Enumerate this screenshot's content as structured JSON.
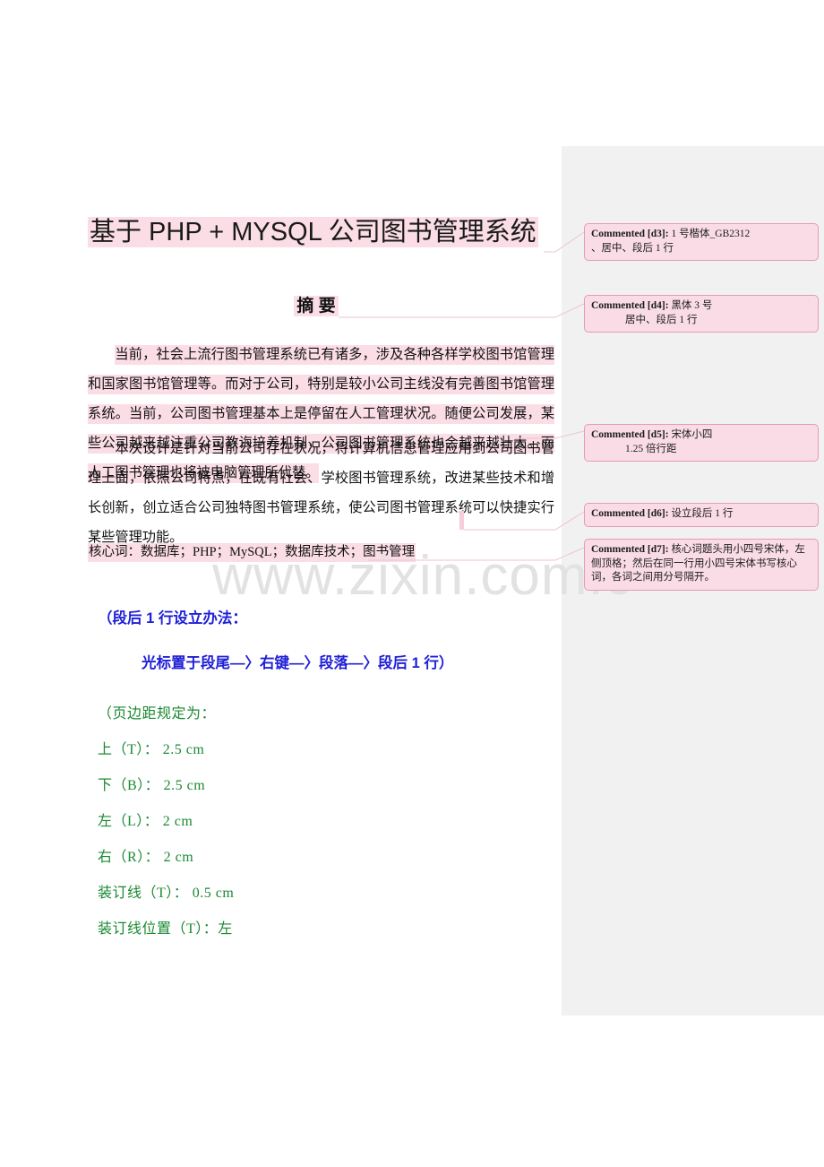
{
  "document": {
    "title": "基于 PHP + MYSQL 公司图书管理系统",
    "abstract_heading": "摘  要",
    "paragraph_1": "当前，社会上流行图书管理系统已有诸多，涉及各种各样学校图书馆管理和国家图书馆管理等。而对于公司，特别是较小公司主线没有完善图书馆管理系统。当前，公司图书管理基本上是停留在人工管理状况。随便公司发展，某些公司越来越注重公司教诲培养机制，公司图书管理系统也会越来越壮大。而人工图书管理也将被电脑管理所代替。",
    "paragraph_2": "本次设计是针对当前公司存在状况，将计算机信息管理应用到公司图书管理上面，依照公司特点，在既有社会、学校图书管理系统，改进某些技术和增长创新，创立适合公司独特图书管理系统，使公司图书管理系统可以快捷实行某些管理功能。",
    "keywords": "核心词：数据库；PHP；MySQL；数据库技术；图书管理"
  },
  "instructions_blue": {
    "line_1": "（段后 1 行设立办法：",
    "line_2": "光标置于段尾—〉右键—〉段落—〉段后 1 行）"
  },
  "instructions_green": {
    "lines": [
      "（页边距规定为：",
      "上（T）： 2.5 cm",
      "下（B）： 2.5 cm",
      "左（L）： 2 cm",
      "右（R）： 2 cm",
      "装订线（T）： 0.5 cm",
      "装订线位置（T）：左"
    ]
  },
  "comments": [
    {
      "tag": "Commented [d3]:",
      "text_1": " 1 号楷体_GB2312",
      "text_2": "、居中、段后 1 行",
      "indent_2": false
    },
    {
      "tag": "Commented [d4]:",
      "text_1": " 黑体 3 号",
      "text_2": "居中、段后 1 行",
      "indent_2": true
    },
    {
      "tag": "Commented [d5]:",
      "text_1": " 宋体小四",
      "text_2": "1.25 倍行距",
      "indent_2": true
    },
    {
      "tag": "Commented [d6]:",
      "text_1": " 设立段后 1 行",
      "text_2": "",
      "indent_2": false
    },
    {
      "tag": "Commented [d7]:",
      "text_1": " 核心词题头用小四号宋体，左侧顶格；",
      "text_2": "然后在同一行用小四号宋体书写核心词，各词之间用分号隔开。",
      "indent_2": false
    }
  ],
  "watermark": {
    "text": "www.zixin.com.c"
  },
  "colors": {
    "highlight_pink": "#fbdde6",
    "comment_fill": "#fadce6",
    "comment_border": "#e59ab4",
    "review_pane": "#f1f1f1",
    "blue_text": "#2020d8",
    "green_text": "#1a8a32",
    "watermark_gray": "#e2e2e2"
  }
}
